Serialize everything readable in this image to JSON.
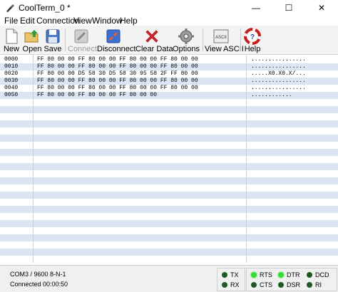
{
  "window": {
    "title": "CoolTerm_0 *",
    "controls": [
      "—",
      "☐",
      "✕"
    ]
  },
  "menu": [
    "File",
    "Edit",
    "Connection",
    "View",
    "Window",
    "Help"
  ],
  "toolbar": {
    "new_label": "New",
    "open_label": "Open",
    "save_label": "Save",
    "connect_label": "Connect",
    "disconnect_label": "Disconnect",
    "clear_label": "Clear Data",
    "options_label": "Options",
    "view_ascii_label": "View ASCII",
    "view_ascii_icon_text": "ASCII",
    "help_label": "Help"
  },
  "data_rows": [
    {
      "addr": "0000",
      "hex": "FF 80 00 00 FF 80 00 00 FF 80 00 00 FF 80 00 00",
      "ascii": "................"
    },
    {
      "addr": "0010",
      "hex": "FF 80 00 00 FF 80 00 00 FF 80 00 00 FF 80 00 00",
      "ascii": "................"
    },
    {
      "addr": "0020",
      "hex": "FF 80 00 00 D5 58 30 D5 58 30 95 58 2F FF 80 00",
      "ascii": ".....X0.X0.X/..."
    },
    {
      "addr": "0030",
      "hex": "FF 80 00 00 FF 80 00 00 FF 80 00 00 FF 80 00 00",
      "ascii": "................"
    },
    {
      "addr": "0040",
      "hex": "FF 80 00 00 FF 80 00 00 FF 80 00 00 FF 80 00 00",
      "ascii": "................"
    },
    {
      "addr": "0050",
      "hex": "FF 80 00 00 FF 80 00 00 FF 80 00 00",
      "ascii": "............"
    }
  ],
  "status": {
    "port_settings": "COM3 / 9600 8-N-1",
    "connection": "Connected 00:00:50"
  },
  "indicators": {
    "tx": {
      "label": "TX",
      "state": "off"
    },
    "rx": {
      "label": "RX",
      "state": "off"
    },
    "rts": {
      "label": "RTS",
      "state": "on"
    },
    "cts": {
      "label": "CTS",
      "state": "off"
    },
    "dtr": {
      "label": "DTR",
      "state": "on"
    },
    "dsr": {
      "label": "DSR",
      "state": "off"
    },
    "dcd": {
      "label": "DCD",
      "state": "off"
    },
    "ri": {
      "label": "RI",
      "state": "off"
    }
  },
  "colors": {
    "stripe": "#dbe6f5",
    "led_on": "#33dd33",
    "led_off": "#1f5a1f",
    "clear_red": "#d9262c",
    "disconnect_blue": "#3d6fd0"
  }
}
